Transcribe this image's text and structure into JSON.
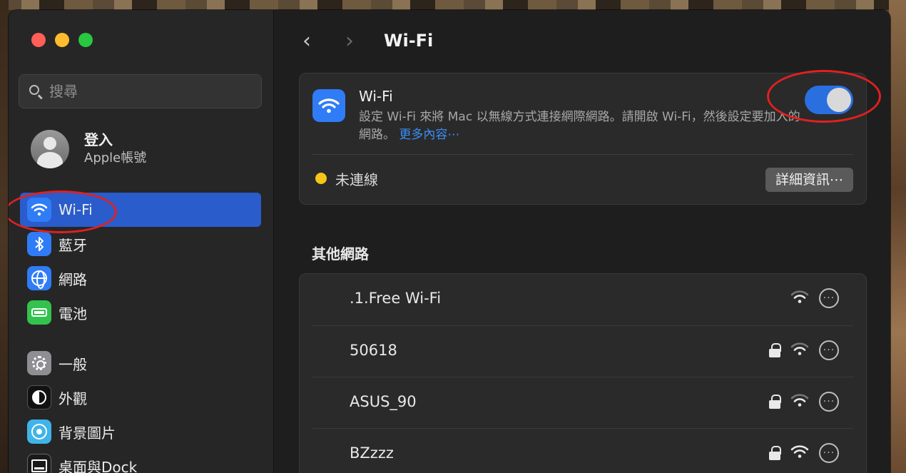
{
  "sidebar": {
    "search_placeholder": "搜尋",
    "account": {
      "name": "登入",
      "subtitle": "Apple帳號"
    },
    "items": [
      {
        "label": "Wi-Fi",
        "icon": "wifi-icon",
        "active": true
      },
      {
        "label": "藍牙",
        "icon": "bluetooth-icon"
      },
      {
        "label": "網路",
        "icon": "network-globe-icon"
      },
      {
        "label": "電池",
        "icon": "battery-icon"
      },
      {
        "label": "一般",
        "icon": "gear-icon"
      },
      {
        "label": "外觀",
        "icon": "appearance-icon"
      },
      {
        "label": "背景圖片",
        "icon": "wallpaper-icon"
      },
      {
        "label": "桌面與Dock",
        "icon": "dock-icon"
      }
    ]
  },
  "toolbar": {
    "back": "‹",
    "forward": "›",
    "title": "Wi-Fi"
  },
  "wifi_card": {
    "title": "Wi-Fi",
    "description": "設定 Wi-Fi 來將 Mac 以無線方式連接網際網路。請開啟 Wi-Fi，然後設定要加入的網路。",
    "more_link": "更多內容⋯",
    "toggle_on": true,
    "status": "未連線",
    "status_color": "#f5c518",
    "details_button": "詳細資訊⋯"
  },
  "other_networks": {
    "title": "其他網路",
    "networks": [
      {
        "name": ".1.Free Wi-Fi",
        "locked": false,
        "signal": "weak"
      },
      {
        "name": "50618",
        "locked": true,
        "signal": "weak"
      },
      {
        "name": "ASUS_90",
        "locked": true,
        "signal": "weak"
      },
      {
        "name": "BZzzz",
        "locked": true,
        "signal": "strong"
      }
    ],
    "more_glyph": "···"
  },
  "colors": {
    "accent": "#2a5ccc",
    "toggle": "#2a6fe0",
    "annotation": "#e02020"
  }
}
